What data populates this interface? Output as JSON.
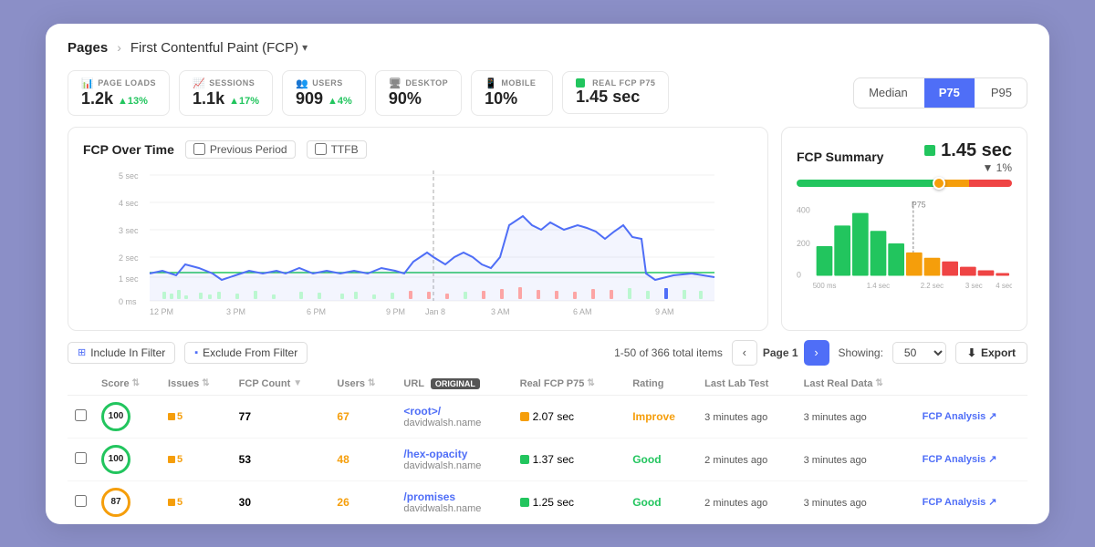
{
  "breadcrumb": {
    "pages": "Pages",
    "separator": "›",
    "current": "First Contentful Paint (FCP)",
    "dropdown": "▾"
  },
  "stats": [
    {
      "id": "page-loads",
      "label": "PAGE LOADS",
      "value": "1.2k",
      "change": "▲13%",
      "direction": "up",
      "icon": "chart-icon"
    },
    {
      "id": "sessions",
      "label": "SESSIONS",
      "value": "1.1k",
      "change": "▲17%",
      "direction": "up",
      "icon": "sessions-icon"
    },
    {
      "id": "users",
      "label": "USERS",
      "value": "909",
      "change": "▲4%",
      "direction": "up",
      "icon": "users-icon"
    },
    {
      "id": "desktop",
      "label": "DESKTOP",
      "value": "90%",
      "change": "",
      "direction": "",
      "icon": "desktop-icon"
    },
    {
      "id": "mobile",
      "label": "MOBILE",
      "value": "10%",
      "change": "",
      "direction": "",
      "icon": "mobile-icon"
    },
    {
      "id": "real-fcp",
      "label": "REAL FCP P75",
      "value": "1.45 sec",
      "change": "",
      "direction": "",
      "icon": "fcp-icon",
      "dot": true
    }
  ],
  "percentile_tabs": [
    {
      "label": "Median",
      "active": false
    },
    {
      "label": "P75",
      "active": true
    },
    {
      "label": "P95",
      "active": false
    }
  ],
  "fcp_chart": {
    "title": "FCP Over Time",
    "toggles": [
      {
        "label": "Previous Period",
        "checked": false
      },
      {
        "label": "TTFB",
        "checked": false
      }
    ],
    "y_labels": [
      "5 sec",
      "4 sec",
      "3 sec",
      "2 sec",
      "1 sec",
      "0 ms"
    ],
    "x_labels": [
      "12 PM",
      "3 PM",
      "6 PM",
      "9 PM",
      "Jan 8",
      "3 AM",
      "6 AM",
      "9 AM"
    ]
  },
  "fcp_summary": {
    "title": "FCP Summary",
    "value": "1.45 sec",
    "change": "▼ 1%",
    "x_labels": [
      "500 ms",
      "1.4 sec",
      "2.2 sec",
      "3 sec",
      "4 sec"
    ],
    "p75_label": "P75"
  },
  "table_controls": {
    "include_filter": "Include In Filter",
    "exclude_filter": "Exclude From Filter",
    "pagination_info": "1-50 of 366 total items",
    "page_label": "Page 1",
    "showing_label": "Showing:",
    "showing_value": "50",
    "export_label": "Export"
  },
  "table_headers": [
    "",
    "Score",
    "Issues",
    "FCP Count",
    "Users",
    "URL",
    "Real FCP P75",
    "Rating",
    "Last Lab Test",
    "Last Real Data",
    ""
  ],
  "table_rows": [
    {
      "score": "100",
      "score_class": "green",
      "issues": "5",
      "fcp_count": "77",
      "users": "67",
      "users_color": "orange",
      "url": "<root>/",
      "domain": "davidwalsh.name",
      "real_fcp": "2.07 sec",
      "fcp_color": "yellow",
      "rating": "Improve",
      "rating_class": "improve",
      "last_lab": "3 minutes ago",
      "last_real": "3 minutes ago",
      "analysis": "FCP Analysis"
    },
    {
      "score": "100",
      "score_class": "green",
      "issues": "5",
      "fcp_count": "53",
      "users": "48",
      "users_color": "orange",
      "url": "/hex-opacity",
      "domain": "davidwalsh.name",
      "real_fcp": "1.37 sec",
      "fcp_color": "green",
      "rating": "Good",
      "rating_class": "good",
      "last_lab": "2 minutes ago",
      "last_real": "3 minutes ago",
      "analysis": "FCP Analysis"
    },
    {
      "score": "87",
      "score_class": "orange",
      "issues": "5",
      "fcp_count": "30",
      "users": "26",
      "users_color": "orange",
      "url": "/promises",
      "domain": "davidwalsh.name",
      "real_fcp": "1.25 sec",
      "fcp_color": "green",
      "rating": "Good",
      "rating_class": "good",
      "last_lab": "2 minutes ago",
      "last_real": "3 minutes ago",
      "analysis": "FCP Analysis"
    }
  ]
}
